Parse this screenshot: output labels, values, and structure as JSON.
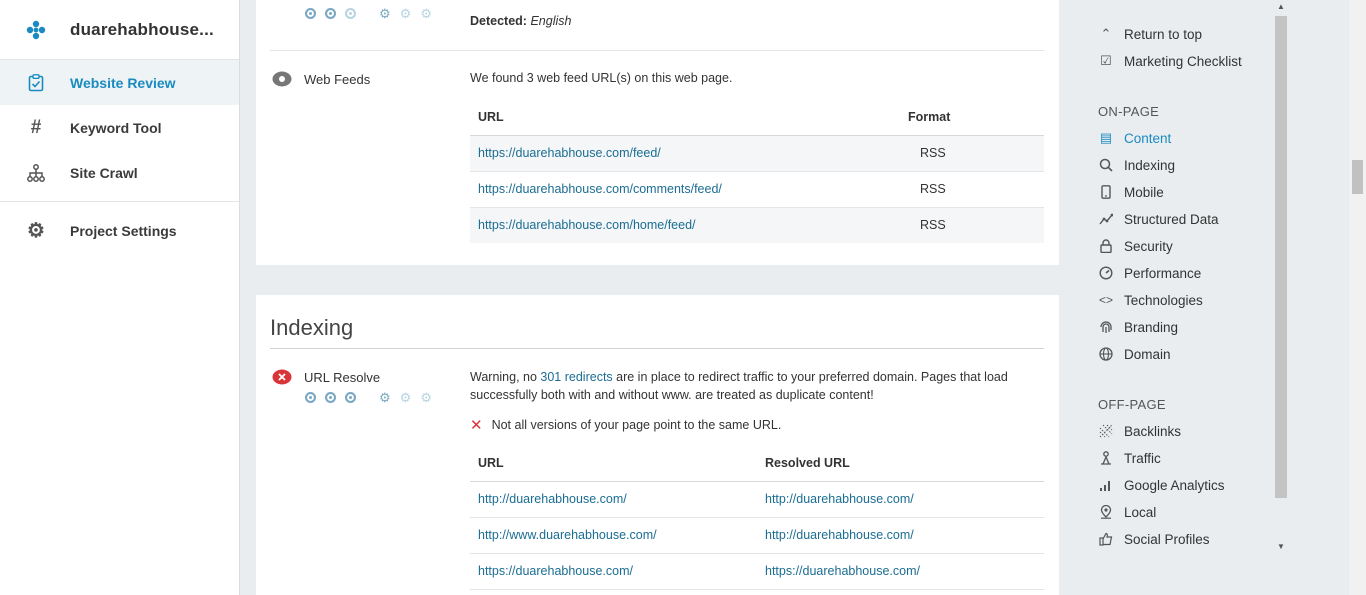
{
  "sidebar": {
    "brand": "duarehabhouse...",
    "items": [
      {
        "label": "Website Review",
        "icon": "clipboard-check-icon",
        "active": true
      },
      {
        "label": "Keyword Tool",
        "icon": "hash-icon",
        "active": false
      },
      {
        "label": "Site Crawl",
        "icon": "sitemap-icon",
        "active": false
      }
    ],
    "settings_label": "Project Settings"
  },
  "language": {
    "detected_label": "Detected:",
    "detected_value": "English"
  },
  "web_feeds": {
    "label": "Web Feeds",
    "summary": "We found 3 web feed URL(s) on this web page.",
    "columns": [
      "URL",
      "Format"
    ],
    "rows": [
      {
        "url": "https://duarehabhouse.com/feed/",
        "format": "RSS"
      },
      {
        "url": "https://duarehabhouse.com/comments/feed/",
        "format": "RSS"
      },
      {
        "url": "https://duarehabhouse.com/home/feed/",
        "format": "RSS"
      }
    ]
  },
  "indexing": {
    "title": "Indexing",
    "url_resolve": {
      "label": "URL Resolve",
      "warning_prefix": "Warning, no ",
      "warning_link": "301 redirects",
      "warning_suffix": " are in place to redirect traffic to your preferred domain. Pages that load successfully both with and without www. are treated as duplicate content!",
      "check": "Not all versions of your page point to the same URL.",
      "columns": [
        "URL",
        "Resolved URL"
      ],
      "rows": [
        {
          "url": "http://duarehabhouse.com/",
          "resolved": "http://duarehabhouse.com/"
        },
        {
          "url": "http://www.duarehabhouse.com/",
          "resolved": "http://duarehabhouse.com/"
        },
        {
          "url": "https://duarehabhouse.com/",
          "resolved": "https://duarehabhouse.com/"
        }
      ]
    }
  },
  "rightnav": {
    "top": [
      {
        "label": "Return to top",
        "icon": "chevron-up-icon"
      },
      {
        "label": "Marketing Checklist",
        "icon": "checkbox-icon"
      }
    ],
    "onpage_heading": "ON-PAGE",
    "onpage": [
      {
        "label": "Content",
        "icon": "document-icon",
        "active": true
      },
      {
        "label": "Indexing",
        "icon": "search-icon"
      },
      {
        "label": "Mobile",
        "icon": "mobile-icon"
      },
      {
        "label": "Structured Data",
        "icon": "graph-icon"
      },
      {
        "label": "Security",
        "icon": "lock-icon"
      },
      {
        "label": "Performance",
        "icon": "speedometer-icon"
      },
      {
        "label": "Technologies",
        "icon": "code-icon"
      },
      {
        "label": "Branding",
        "icon": "fingerprint-icon"
      },
      {
        "label": "Domain",
        "icon": "globe-icon"
      }
    ],
    "offpage_heading": "OFF-PAGE",
    "offpage": [
      {
        "label": "Backlinks",
        "icon": "link-icon"
      },
      {
        "label": "Traffic",
        "icon": "person-icon"
      },
      {
        "label": "Google Analytics",
        "icon": "bar-chart-icon"
      },
      {
        "label": "Local",
        "icon": "location-pin-icon"
      },
      {
        "label": "Social Profiles",
        "icon": "thumbs-up-icon"
      }
    ]
  },
  "colors": {
    "accent": "#1a8bc1",
    "link": "#1b6d93",
    "error": "#d9343a"
  }
}
